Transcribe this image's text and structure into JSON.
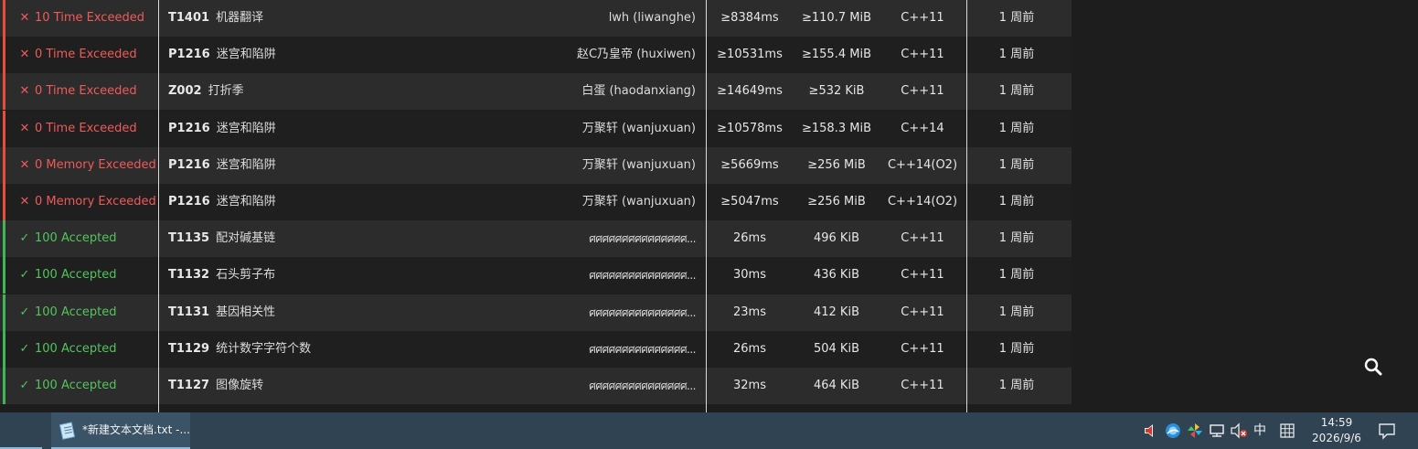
{
  "submissions": [
    {
      "result": "fail",
      "status_icon": "✕",
      "status": "10 Time Exceeded",
      "pid": "T1401",
      "title": "机器翻译",
      "user": "lwh (liwanghe)",
      "time": "≥8384ms",
      "memory": "≥110.7 MiB",
      "lang": "C++11",
      "when": "1 周前"
    },
    {
      "result": "fail",
      "status_icon": "✕",
      "status": "0 Time Exceeded",
      "pid": "P1216",
      "title": "迷宫和陷阱",
      "user": "赵C乃皇帝 (huxiwen)",
      "time": "≥10531ms",
      "memory": "≥155.4 MiB",
      "lang": "C++11",
      "when": "1 周前"
    },
    {
      "result": "fail",
      "status_icon": "✕",
      "status": "0 Time Exceeded",
      "pid": "Z002",
      "title": "打折季",
      "user": "白蛋 (haodanxiang)",
      "time": "≥14649ms",
      "memory": "≥532 KiB",
      "lang": "C++11",
      "when": "1 周前"
    },
    {
      "result": "fail",
      "status_icon": "✕",
      "status": "0 Time Exceeded",
      "pid": "P1216",
      "title": "迷宫和陷阱",
      "user": "万聚轩 (wanjuxuan)",
      "time": "≥10578ms",
      "memory": "≥158.3 MiB",
      "lang": "C++14",
      "when": "1 周前"
    },
    {
      "result": "fail",
      "status_icon": "✕",
      "status": "0 Memory Exceeded",
      "pid": "P1216",
      "title": "迷宫和陷阱",
      "user": "万聚轩 (wanjuxuan)",
      "time": "≥5669ms",
      "memory": "≥256 MiB",
      "lang": "C++14(O2)",
      "when": "1 周前"
    },
    {
      "result": "fail",
      "status_icon": "✕",
      "status": "0 Memory Exceeded",
      "pid": "P1216",
      "title": "迷宫和陷阱",
      "user": "万聚轩 (wanjuxuan)",
      "time": "≥5047ms",
      "memory": "≥256 MiB",
      "lang": "C++14(O2)",
      "when": "1 周前"
    },
    {
      "result": "pass",
      "status_icon": "✓",
      "status": "100 Accepted",
      "pid": "T1135",
      "title": "配对碱基链",
      "user": "ศศศศศศศศศศศศศศศ...",
      "time": "26ms",
      "memory": "496 KiB",
      "lang": "C++11",
      "when": "1 周前"
    },
    {
      "result": "pass",
      "status_icon": "✓",
      "status": "100 Accepted",
      "pid": "T1132",
      "title": "石头剪子布",
      "user": "ศศศศศศศศศศศศศศศ...",
      "time": "30ms",
      "memory": "436 KiB",
      "lang": "C++11",
      "when": "1 周前"
    },
    {
      "result": "pass",
      "status_icon": "✓",
      "status": "100 Accepted",
      "pid": "T1131",
      "title": "基因相关性",
      "user": "ศศศศศศศศศศศศศศศ...",
      "time": "23ms",
      "memory": "412 KiB",
      "lang": "C++11",
      "when": "1 周前"
    },
    {
      "result": "pass",
      "status_icon": "✓",
      "status": "100 Accepted",
      "pid": "T1129",
      "title": "统计数字字符个数",
      "user": "ศศศศศศศศศศศศศศศ...",
      "time": "26ms",
      "memory": "504 KiB",
      "lang": "C++11",
      "when": "1 周前"
    },
    {
      "result": "pass",
      "status_icon": "✓",
      "status": "100 Accepted",
      "pid": "T1127",
      "title": "图像旋转",
      "user": "ศศศศศศศศศศศศศศศ...",
      "time": "32ms",
      "memory": "464 KiB",
      "lang": "C++11",
      "when": "1 周前"
    }
  ],
  "colors": {
    "fail": "#ef5a5a",
    "pass": "#52c45d",
    "row_even": "#2c2c2c",
    "row_odd": "#1f1f1f",
    "taskbar": "#2f4353"
  },
  "search": {
    "icon": "search-icon"
  },
  "taskbar": {
    "task_label": "*新建文本文档.txt -...",
    "task_icon": "notepad-icon",
    "tray_icons": [
      "speaker-icon",
      "browser-icon",
      "pinwheel-icon",
      "network-icon",
      "muted-volume-icon",
      "input-grid-icon"
    ],
    "ime_label": "中",
    "time": "14:59",
    "date": "2026/9/6",
    "notify_icon": "notification-icon"
  }
}
